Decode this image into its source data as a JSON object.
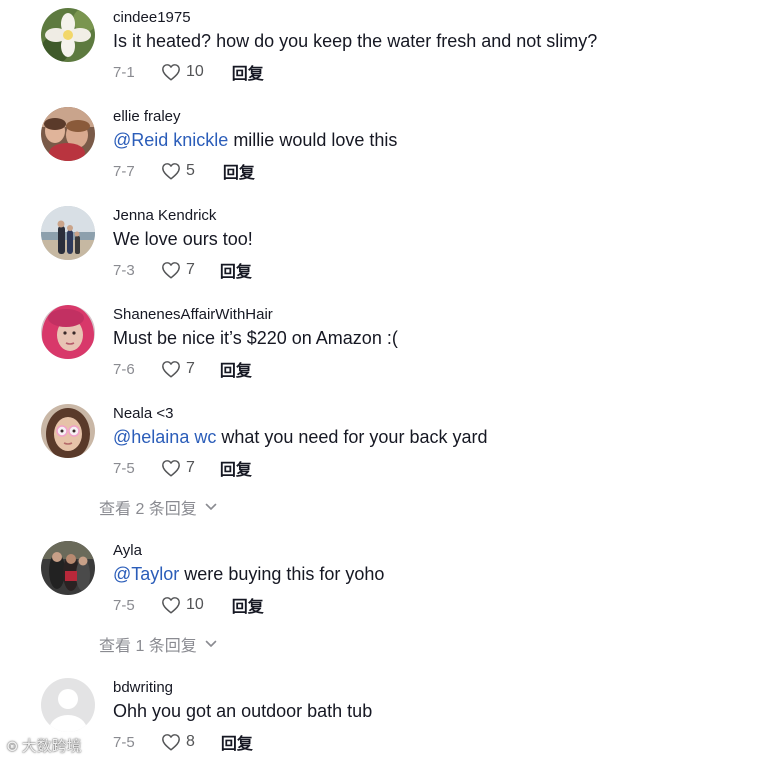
{
  "reply_label": "回复",
  "comments": [
    {
      "username": "cindee1975",
      "mention": "",
      "text": "Is it heated? how do you keep the water fresh and not slimy?",
      "date": "7-1",
      "likes": "10",
      "avatar": "white-flower-photo"
    },
    {
      "username": "ellie fraley",
      "mention": "@Reid knickle",
      "text": " millie would love this",
      "date": "7-7",
      "likes": "5",
      "avatar": "group-selfie-photo"
    },
    {
      "username": "Jenna Kendrick",
      "mention": "",
      "text": "We love ours too!",
      "date": "7-3",
      "likes": "7",
      "avatar": "family-beach-photo"
    },
    {
      "username": "ShanenesAffairWithHair",
      "mention": "",
      "text": "Must be nice it’s $220 on Amazon :(",
      "date": "7-6",
      "likes": "7",
      "avatar": "pink-hair-selfie"
    },
    {
      "username": "Neala <3",
      "mention": "@helaina wc",
      "text": " what you need for your back yard",
      "date": "7-5",
      "likes": "7",
      "avatar": "glasses-selfie"
    },
    {
      "username": "Ayla",
      "mention": "@Taylor",
      "text": " were buying this for yoho",
      "date": "7-5",
      "likes": "10",
      "avatar": "group-photo"
    },
    {
      "username": "bdwriting",
      "mention": "",
      "text": "Ohh you got an outdoor bath tub",
      "date": "7-5",
      "likes": "8",
      "avatar": "default-avatar"
    }
  ],
  "view_replies": [
    {
      "label": "查看 2 条回复"
    },
    {
      "label": "查看 1 条回复"
    }
  ],
  "watermark": "大数跨境",
  "colors": {
    "text": "#161823",
    "mention": "#2b5db9",
    "muted": "#8a8b91",
    "like_count": "#545557"
  }
}
